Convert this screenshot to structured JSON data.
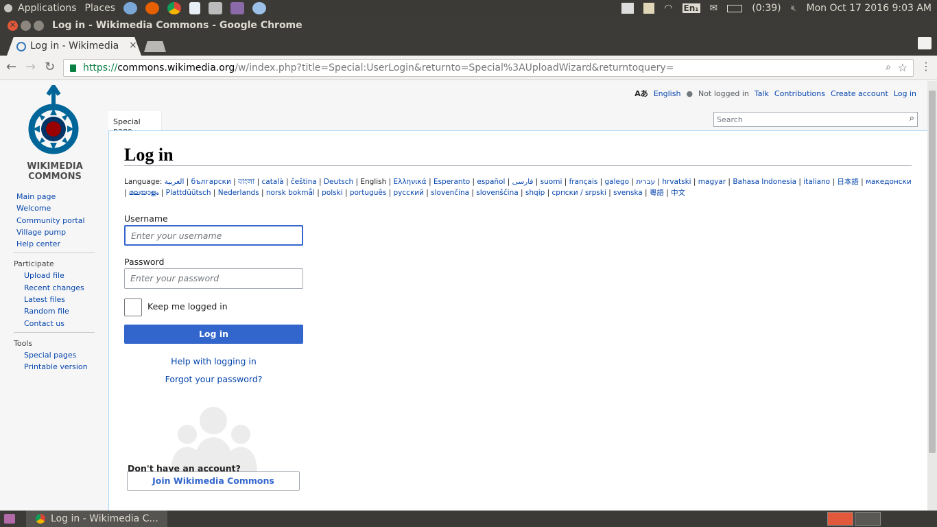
{
  "topbar": {
    "applications": "Applications",
    "places": "Places",
    "battery": "(0:39)",
    "keyboard": "En₁",
    "datetime": "Mon Oct 17 2016  9:03 AM"
  },
  "window": {
    "title": "Log in - Wikimedia Commons - Google Chrome"
  },
  "tab": {
    "title": "Log in - Wikimedia Commons",
    "close": "×"
  },
  "omnibox": {
    "scheme": "https://",
    "host": "commons.wikimedia.org",
    "path": "/w/index.php?title=Special:UserLogin&returnto=Special%3AUploadWizard&returntoquery="
  },
  "logo": {
    "line1": "WIKIMEDIA",
    "line2": "COMMONS"
  },
  "sidebar": {
    "main": [
      "Main page",
      "Welcome",
      "Community portal",
      "Village pump",
      "Help center"
    ],
    "participate_heading": "Participate",
    "participate": [
      "Upload file",
      "Recent changes",
      "Latest files",
      "Random file",
      "Contact us"
    ],
    "tools_heading": "Tools",
    "tools": [
      "Special pages",
      "Printable version"
    ]
  },
  "personal": {
    "language": "English",
    "not_logged_in": "Not logged in",
    "talk": "Talk",
    "contributions": "Contributions",
    "create_account": "Create account",
    "login": "Log in"
  },
  "page_tab": "Special page",
  "search": {
    "placeholder": "Search"
  },
  "heading": "Log in",
  "language_label": "Language:",
  "languages": [
    "العربية",
    "български",
    "বাংলা",
    "català",
    "čeština",
    "Deutsch",
    "English",
    "Ελληνικά",
    "Esperanto",
    "español",
    "فارسی",
    "suomi",
    "français",
    "galego",
    "עברית",
    "hrvatski",
    "magyar",
    "Bahasa Indonesia",
    "italiano",
    "日本語",
    "македонски",
    "മലയാളം",
    "Plattdüütsch",
    "Nederlands",
    "norsk bokmål",
    "polski",
    "português",
    "русский",
    "slovenčina",
    "slovenščina",
    "shqip",
    "српски / srpski",
    "svenska",
    "粵語",
    "中文"
  ],
  "form": {
    "username_label": "Username",
    "username_placeholder": "Enter your username",
    "password_label": "Password",
    "password_placeholder": "Enter your password",
    "remember_label": "Keep me logged in",
    "login_button": "Log in",
    "help_link": "Help with logging in",
    "forgot_link": "Forgot your password?"
  },
  "join": {
    "question": "Don't have an account?",
    "button": "Join Wikimedia Commons"
  },
  "taskbar": {
    "task_title": "Log in - Wikimedia C..."
  },
  "colors": {
    "link": "#0645ad",
    "primary_button": "#3366cc",
    "ubuntu_panel": "#3b3a36",
    "close_button": "#e2583a"
  }
}
